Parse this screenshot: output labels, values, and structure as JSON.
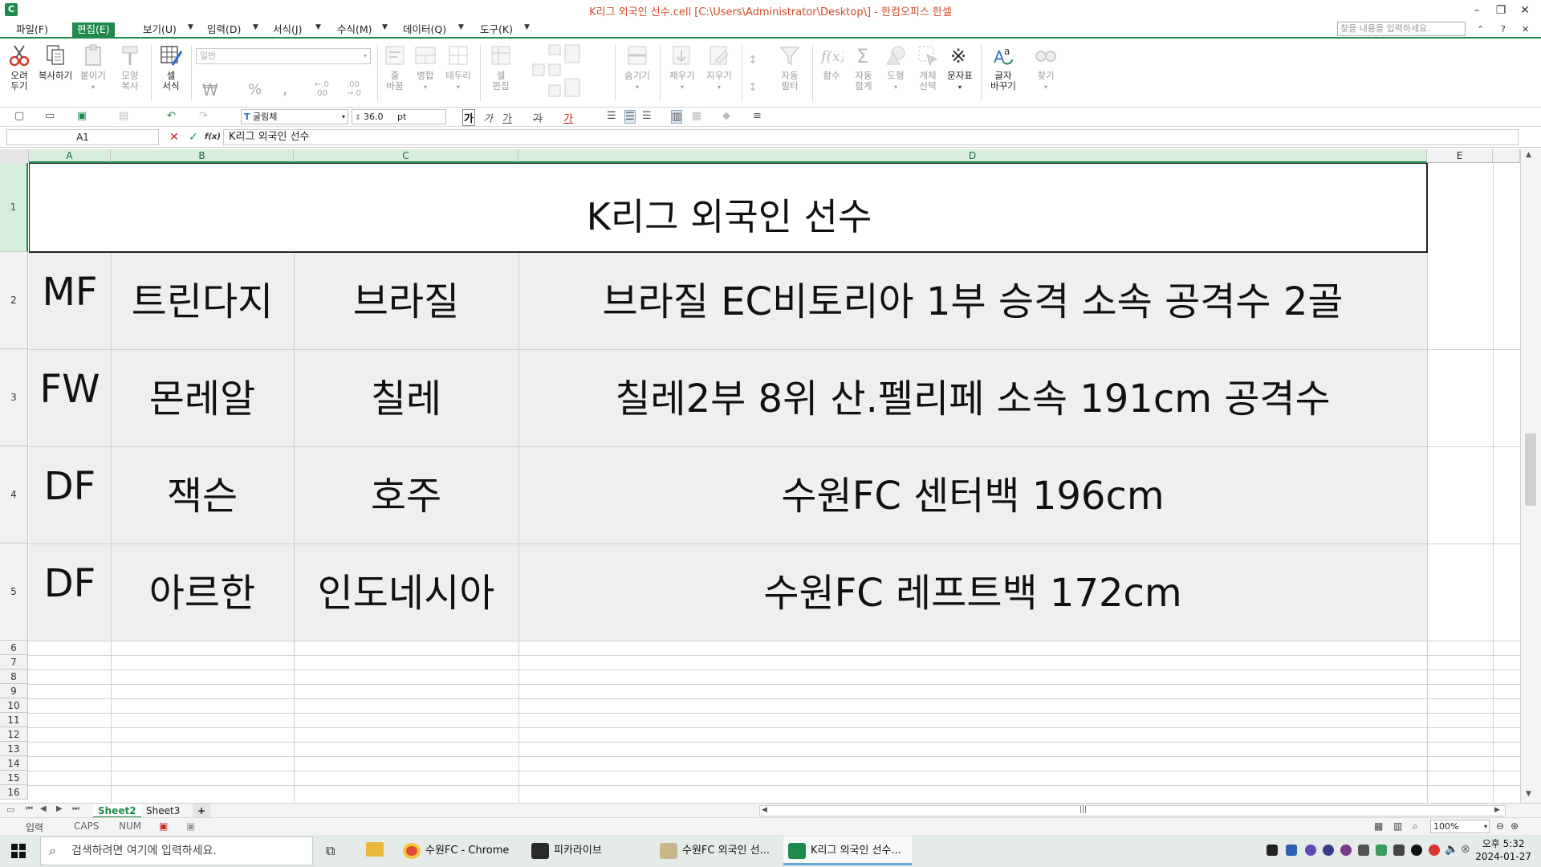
{
  "window": {
    "title": "K리그 외국인 선수.cell [C:\\Users\\Administrator\\Desktop\\] - 한컴오피스 한셀",
    "app_icon": "C",
    "controls": [
      "–",
      "❐",
      "✕"
    ]
  },
  "menu": {
    "items": [
      {
        "label": "파일(F)",
        "active": false
      },
      {
        "label": "편집(E)",
        "active": true
      },
      {
        "label": "보기(U)",
        "active": false
      },
      {
        "label": "입력(D)",
        "active": false
      },
      {
        "label": "서식(J)",
        "active": false
      },
      {
        "label": "수식(M)",
        "active": false
      },
      {
        "label": "데이터(Q)",
        "active": false
      },
      {
        "label": "도구(K)",
        "active": false
      }
    ],
    "search_placeholder": "찾을 내용을 입력하세요."
  },
  "ribbon": {
    "buttons": [
      {
        "label1": "오려",
        "label2": "두기",
        "icon": "scissors-icon",
        "enabled": true
      },
      {
        "label1": "복사하기",
        "label2": "",
        "icon": "copy-icon",
        "enabled": true
      },
      {
        "label1": "붙이기",
        "label2": "",
        "icon": "paste-icon",
        "enabled": false
      },
      {
        "label1": "모양",
        "label2": "복사",
        "icon": "format-painter-icon",
        "enabled": false
      },
      {
        "label1": "셀",
        "label2": "서식",
        "icon": "cell-format-icon",
        "enabled": true
      },
      {
        "label1": "줄",
        "label2": "바꿈",
        "icon": "wrap-icon",
        "enabled": false
      },
      {
        "label1": "병합",
        "label2": "",
        "icon": "merge-icon",
        "enabled": false
      },
      {
        "label1": "테두리",
        "label2": "",
        "icon": "border-icon",
        "enabled": false
      },
      {
        "label1": "셀",
        "label2": "편집",
        "icon": "cell-edit-icon",
        "enabled": false
      },
      {
        "label1": "숨기기",
        "label2": "",
        "icon": "hide-icon",
        "enabled": false
      },
      {
        "label1": "채우기",
        "label2": "",
        "icon": "fill-icon",
        "enabled": false
      },
      {
        "label1": "지우기",
        "label2": "",
        "icon": "eraser-icon",
        "enabled": false
      },
      {
        "label1": "자동",
        "label2": "필터",
        "icon": "autofilter-icon",
        "enabled": false
      },
      {
        "label1": "함수",
        "label2": "",
        "icon": "function-icon",
        "enabled": false
      },
      {
        "label1": "자동",
        "label2": "합계",
        "icon": "autosum-icon",
        "enabled": false
      },
      {
        "label1": "도형",
        "label2": "",
        "icon": "shape-icon",
        "enabled": false
      },
      {
        "label1": "개체",
        "label2": "선택",
        "icon": "object-select-icon",
        "enabled": false
      },
      {
        "label1": "문자표",
        "label2": "",
        "icon": "symbol-icon",
        "enabled": true
      },
      {
        "label1": "글자",
        "label2": "바꾸기",
        "icon": "text-replace-icon",
        "enabled": true
      },
      {
        "label1": "찾기",
        "label2": "",
        "icon": "find-icon",
        "enabled": false
      }
    ],
    "number_format": "일반",
    "currency_symbol": "₩",
    "percent_symbol": "%",
    "comma_symbol": ","
  },
  "format_bar": {
    "font_name": "굴림체",
    "font_size": "36.0",
    "font_unit": "pt",
    "bold_glyph": "가",
    "italic_glyph": "가",
    "underline_glyph": "가",
    "strike_glyph": "가",
    "color_glyph": "가"
  },
  "formula_bar": {
    "name_box": "A1",
    "cancel": "✕",
    "confirm": "✓",
    "fx": "f(x)",
    "content": "K리그 외국인 선수"
  },
  "sheet": {
    "columns": [
      "A",
      "B",
      "C",
      "D",
      "E"
    ],
    "rows": [
      "1",
      "2",
      "3",
      "4",
      "5",
      "6",
      "7",
      "8",
      "9",
      "10",
      "11",
      "12",
      "13",
      "14",
      "15",
      "16"
    ],
    "title": "K리그 외국인 선수",
    "data": [
      {
        "pos": "MF",
        "name": "트린다지",
        "country": "브라질",
        "note": "브라질 EC비토리아 1부 승격 소속 공격수 2골"
      },
      {
        "pos": "FW",
        "name": "몬레알",
        "country": "칠레",
        "note": "칠레2부 8위 산.펠리페 소속 191cm 공격수"
      },
      {
        "pos": "DF",
        "name": "잭슨",
        "country": "호주",
        "note": "수원FC 센터백 196cm"
      },
      {
        "pos": "DF",
        "name": "아르한",
        "country": "인도네시아",
        "note": "수원FC 레프트백 172cm"
      }
    ]
  },
  "tabs": {
    "sheets": [
      "Sheet2",
      "Sheet3"
    ],
    "active": "Sheet2",
    "add": "+"
  },
  "status": {
    "mode": "입력",
    "caps": "CAPS",
    "num": "NUM",
    "zoom": "100%"
  },
  "taskbar": {
    "search_placeholder": "검색하려면 여기에 입력하세요.",
    "apps": [
      {
        "label": "수원FC - Chrome",
        "color": "#e0483b"
      },
      {
        "label": "피카라이브",
        "color": "#2a2a2a"
      },
      {
        "label": "수원FC 외국인 선...",
        "color": "#8a7a5a"
      },
      {
        "label": "K리그 외국인 선수...",
        "color": "#1f8a4c"
      }
    ],
    "time": "오후 5:32",
    "date": "2024-01-27"
  }
}
